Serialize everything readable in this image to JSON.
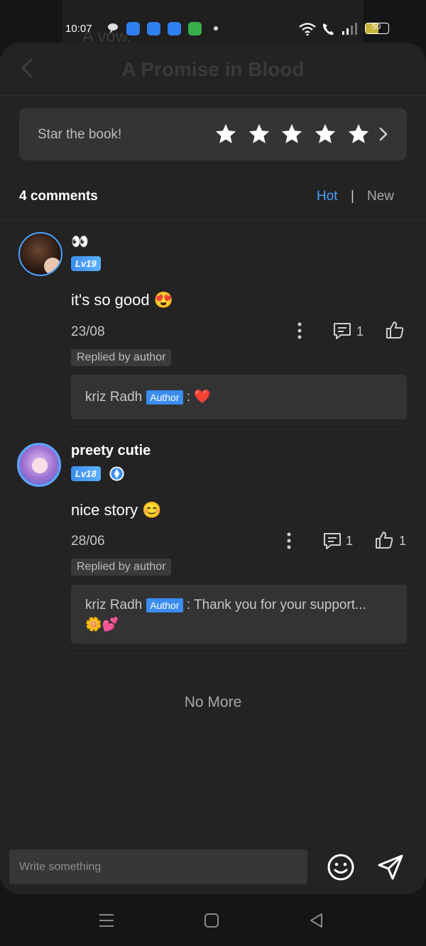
{
  "background": {
    "story_text": "A vow."
  },
  "status_bar": {
    "time": "10:07",
    "battery": "50"
  },
  "header": {
    "title": "A Promise in Blood"
  },
  "star_card": {
    "label": "Star the book!"
  },
  "comments_header": {
    "count": "4 comments",
    "sort_hot": "Hot",
    "divider": "|",
    "sort_new": "New"
  },
  "comments": [
    {
      "username": "👀",
      "level": "Lv19",
      "text": "it's so good 😍",
      "date": "23/08",
      "reply_count": "1",
      "like_count": "",
      "replied_tag": "Replied by author",
      "author_reply": {
        "name": "kriz Radh",
        "tag": "Author",
        "text": " : ❤️"
      }
    },
    {
      "username": "preety cutie",
      "level": "Lv18",
      "text": "nice story 😊",
      "date": "28/06",
      "reply_count": "1",
      "like_count": "1",
      "replied_tag": "Replied by author",
      "author_reply": {
        "name": "kriz Radh",
        "tag": "Author",
        "text": " : Thank you for your support...",
        "text2": "🌼💕"
      }
    }
  ],
  "footer": {
    "no_more": "No More"
  },
  "input": {
    "placeholder": "Write something"
  },
  "colors": {
    "accent": "#4aa1ff",
    "panel": "#232323",
    "card": "#343434"
  }
}
